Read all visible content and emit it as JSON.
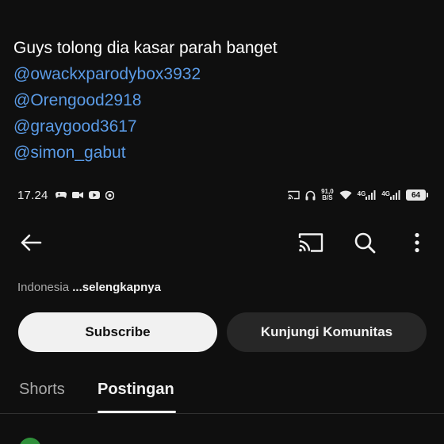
{
  "caption": {
    "text": "Guys tolong dia kasar parah banget",
    "mentions": [
      "@owackxparodybox3932",
      "@Orengood2918",
      "@graygood3617",
      "@simon_gabut"
    ]
  },
  "statusbar": {
    "time": "17.24",
    "left_icons": [
      "gamepad-icon",
      "video-icon",
      "youtube-icon",
      "chrome-icon"
    ],
    "net_speed": "91,0",
    "net_speed_unit": "B/S",
    "signal_1_label": "4G",
    "signal_2_label": "4G",
    "battery": "64"
  },
  "appbar": {
    "icons": [
      "back-arrow-icon",
      "cast-icon",
      "search-icon",
      "more-vert-icon"
    ]
  },
  "channel": {
    "country": "Indonesia",
    "more_link": "...selengkapnya"
  },
  "buttons": {
    "subscribe": "Subscribe",
    "community": "Kunjungi Komunitas"
  },
  "tabs": {
    "shorts": "Shorts",
    "posts": "Postingan",
    "active": "posts"
  },
  "colors": {
    "background": "#0f0f0f",
    "mention": "#5b9be6",
    "subscribe_bg": "#f1f1f1",
    "secondary_button_bg": "#272727"
  }
}
